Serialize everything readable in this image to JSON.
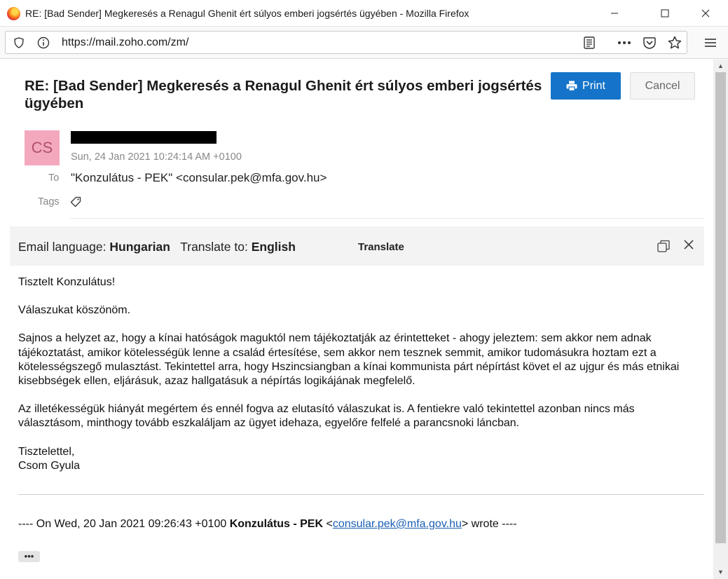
{
  "window": {
    "title": "RE: [Bad Sender] Megkeresés a Renagul Ghenit ért súlyos emberi jogsértés ügyében - Mozilla Firefox"
  },
  "browser": {
    "url": "https://mail.zoho.com/zm/",
    "icons": [
      "shield-icon",
      "info-icon",
      "reader-view-icon",
      "more-icon",
      "pocket-icon",
      "bookmark-star-icon",
      "menu-icon"
    ]
  },
  "email": {
    "subject": "RE: [Bad Sender] Megkeresés a Renagul Ghenit ért súlyos emberi jogsértés ügyében",
    "print_label": "Print",
    "cancel_label": "Cancel",
    "avatar_initials": "CS",
    "date": "Sun, 24 Jan 2021 10:24:14 AM +0100",
    "to_label": "To",
    "to_value": "\"Konzulátus - PEK\" <consular.pek@mfa.gov.hu>",
    "tags_label": "Tags"
  },
  "translate_bar": {
    "email_language_label": "Email language:",
    "email_language_value": "Hungarian",
    "translate_to_label": "Translate to:",
    "translate_to_value": "English",
    "translate_button": "Translate"
  },
  "body": {
    "greeting": "Tisztelt Konzulátus!",
    "p1": "Válaszukat köszönöm.",
    "p2": "Sajnos a helyzet az, hogy a kínai hatóságok maguktól nem tájékoztatják az érintetteket - ahogy jeleztem: sem akkor nem adnak tájékoztatást, amikor kötelességük lenne a család értesítése, sem akkor nem tesznek semmit, amikor tudomásukra hoztam ezt a kötelességszegő mulasztást. Tekintettel arra, hogy Hszincsiangban a kínai kommunista párt népírtást követ el az ujgur és más etnikai kisebbségek ellen, eljárásuk, azaz hallgatásuk a népírtás logikájának megfelelő.",
    "p3": "Az illetékességük hiányát megértem és ennél fogva az elutasító válaszukat is. A fentiekre való tekintettel azonban nincs más választásom, minthogy tovább eszkaláljam az ügyet idehaza, egyelőre felfelé a parancsnoki láncban.",
    "closing": "Tisztelettel,",
    "signature": "Csom Gyula"
  },
  "quote": {
    "prefix": "---- On Wed, 20 Jan 2021 09:26:43 +0100 ",
    "sender_name": "Konzulátus - PEK",
    "open": " <",
    "email": "consular.pek@mfa.gov.hu",
    "suffix": "> wrote ----",
    "expand_label": "•••"
  }
}
